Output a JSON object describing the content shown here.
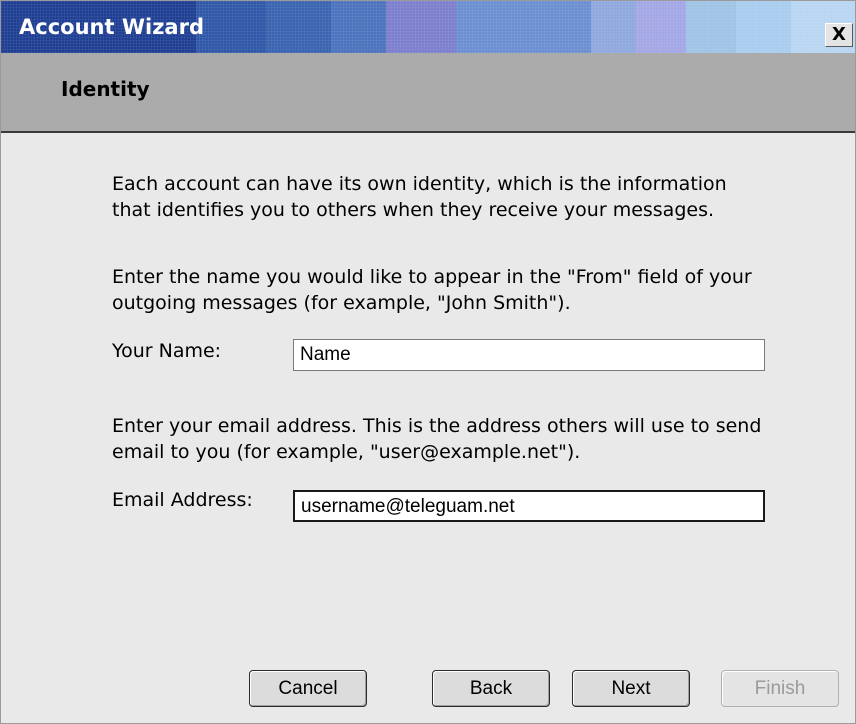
{
  "window": {
    "title": "Account Wizard",
    "close_label": "X"
  },
  "page": {
    "title": "Identity"
  },
  "content": {
    "intro": "Each account can have its own identity, which is the information\nthat identifies you to others when they receive your messages.",
    "name_instruction": "Enter the name you would like to appear in the \"From\" field of your\noutgoing messages (for example, \"John Smith\").",
    "name_label": "Your Name:",
    "name_value": "Name",
    "email_instruction": "Enter your email address. This is the address others will use to send\nemail to you (for example, \"user@example.net\").",
    "email_label": "Email Address:",
    "email_value": "username@teleguam.net"
  },
  "buttons": {
    "cancel": "Cancel",
    "back": "Back",
    "next": "Next",
    "finish": "Finish"
  }
}
